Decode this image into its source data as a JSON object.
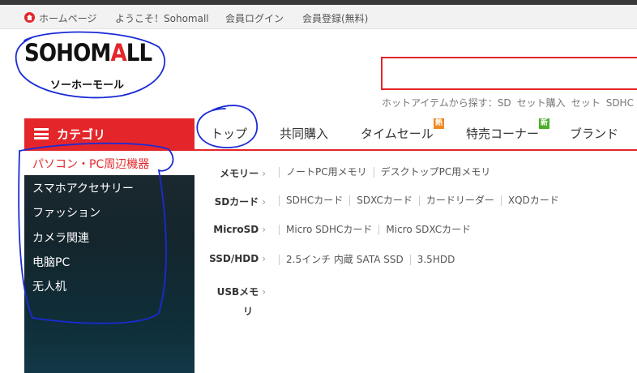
{
  "topbar": {
    "home": "ホームページ",
    "welcome": "ようこそ！Sohomall",
    "login": "会員ログイン",
    "register": "会員登録(無料)"
  },
  "logo": {
    "brand_pre": "SOHOM",
    "brand_cart": "A",
    "brand_post": "LL",
    "kana": "ソーホーモール"
  },
  "search": {
    "placeholder": "",
    "hot_label": "ホットアイテムから探す：",
    "hot_items": [
      "SD",
      "セット購入",
      "セット",
      "SDHC"
    ]
  },
  "nav": {
    "category_label": "カテゴリ",
    "items": [
      "トップ",
      "共同購入",
      "タイムセール",
      "特売コーナー",
      "ブランド"
    ],
    "badge_hot": "熱",
    "badge_new": "新"
  },
  "categories": [
    "パソコン・PC周辺機器",
    "スマホアクセサリー",
    "ファッション",
    "カメラ関連",
    "电脑PC",
    "无人机"
  ],
  "subcategories": [
    {
      "head": "メモリー",
      "items": [
        "ノートPC用メモリ",
        "デスクトップPC用メモリ"
      ]
    },
    {
      "head": "SDカード",
      "items": [
        "SDHCカード",
        "SDXCカード",
        "カードリーダー",
        "XQDカード"
      ]
    },
    {
      "head": "MicroSD",
      "items": [
        "Micro SDHCカード",
        "Micro SDXCカード"
      ]
    },
    {
      "head": "SSD/HDD",
      "items": [
        "2.5インチ 内蔵 SATA SSD",
        "3.5HDD"
      ]
    },
    {
      "head_line1": "USBメモ",
      "head_line2": "リ",
      "items": []
    }
  ],
  "arrow": "›",
  "colors": {
    "accent": "#e4262a",
    "annotation": "#1a2bd6"
  }
}
